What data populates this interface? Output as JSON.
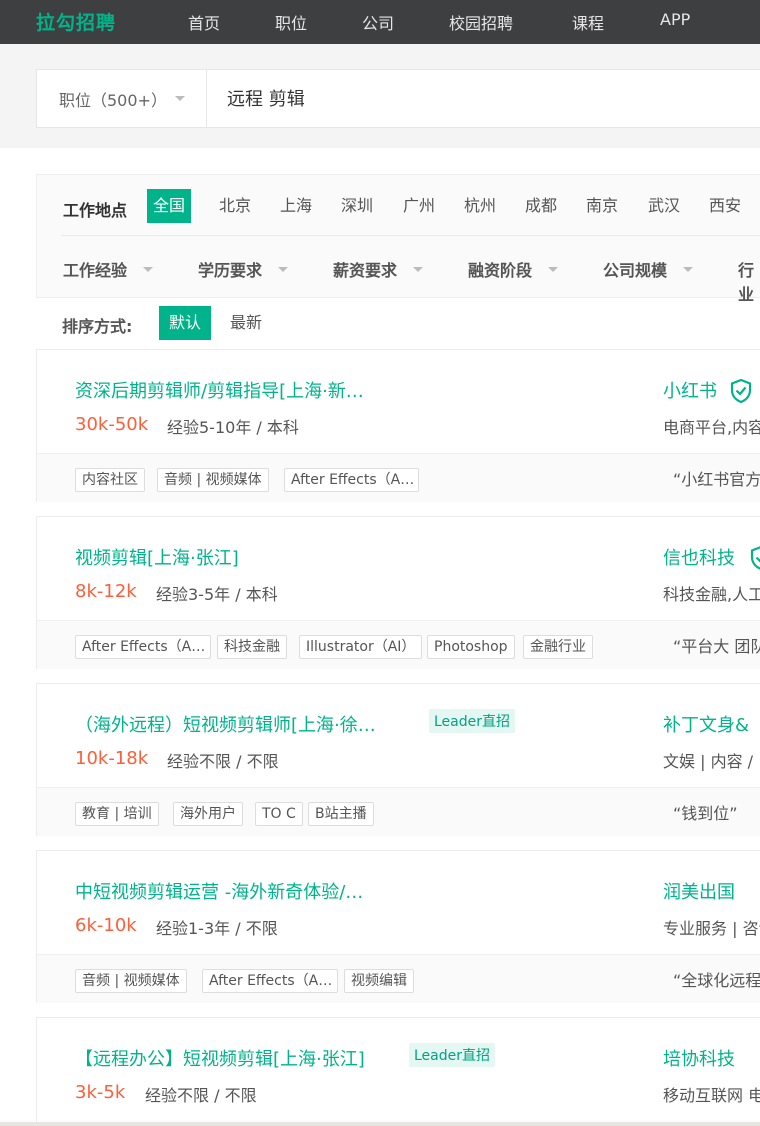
{
  "topnav": {
    "logo": "拉勾招聘",
    "links": [
      "首页",
      "职位",
      "公司",
      "校园招聘",
      "课程",
      "APP"
    ]
  },
  "search": {
    "type_label": "职位（500+）",
    "query": "远程 剪辑"
  },
  "filters": {
    "location_title": "工作地点",
    "cities": [
      "全国",
      "北京",
      "上海",
      "深圳",
      "广州",
      "杭州",
      "成都",
      "南京",
      "武汉",
      "西安"
    ],
    "active_city": "全国",
    "dropdowns": [
      "工作经验",
      "学历要求",
      "薪资要求",
      "融资阶段",
      "公司规模",
      "行业"
    ]
  },
  "sort": {
    "label": "排序方式:",
    "options": [
      "默认",
      "最新"
    ],
    "active": "默认"
  },
  "jobs": [
    {
      "title": "资深后期剪辑师/剪辑指导[上海·新…",
      "salary": "30k-50k",
      "requirements": "经验5-10年 / 本科",
      "leader": "",
      "tags": [
        "内容社区",
        "音频 | 视频媒体",
        "After Effects（A…"
      ],
      "company": "小红书",
      "verified": true,
      "industry": "电商平台,内容社区",
      "slogan": "“小红书官方"
    },
    {
      "title": "视频剪辑[上海·张江]",
      "salary": "8k-12k",
      "requirements": "经验3-5年 / 本科",
      "leader": "",
      "tags": [
        "After Effects（A…",
        "科技金融",
        "Illustrator（AI）",
        "Photoshop",
        "金融行业"
      ],
      "company": "信也科技",
      "verified": true,
      "industry": "科技金融,人工智能",
      "slogan": "“平台大 团队"
    },
    {
      "title": "（海外远程）短视频剪辑师[上海·徐…",
      "salary": "10k-18k",
      "requirements": "经验不限 / 不限",
      "leader": "Leader直招",
      "tags": [
        "教育 | 培训",
        "海外用户",
        "TO C",
        "B站主播"
      ],
      "company": "补丁文身&",
      "verified": false,
      "industry": "文娱 | 内容 / ",
      "slogan": "“钱到位”"
    },
    {
      "title": "中短视频剪辑运营 -海外新奇体验/…",
      "salary": "6k-10k",
      "requirements": "经验1-3年 / 不限",
      "leader": "",
      "tags": [
        "音频 | 视频媒体",
        "After Effects（A…",
        "视频编辑"
      ],
      "company": "润美出国",
      "verified": false,
      "industry": "专业服务 | 咨询",
      "slogan": "“全球化远程"
    },
    {
      "title": "【远程办公】短视频剪辑[上海·张江]",
      "salary": "3k-5k",
      "requirements": "经验不限 / 不限",
      "leader": "Leader直招",
      "tags": [],
      "company": "培协科技",
      "verified": false,
      "industry": "移动互联网 电",
      "slogan": ""
    }
  ],
  "colors": {
    "brand": "#00b38a",
    "salary": "#fd5f39",
    "nav_bg": "#3d3f41"
  }
}
